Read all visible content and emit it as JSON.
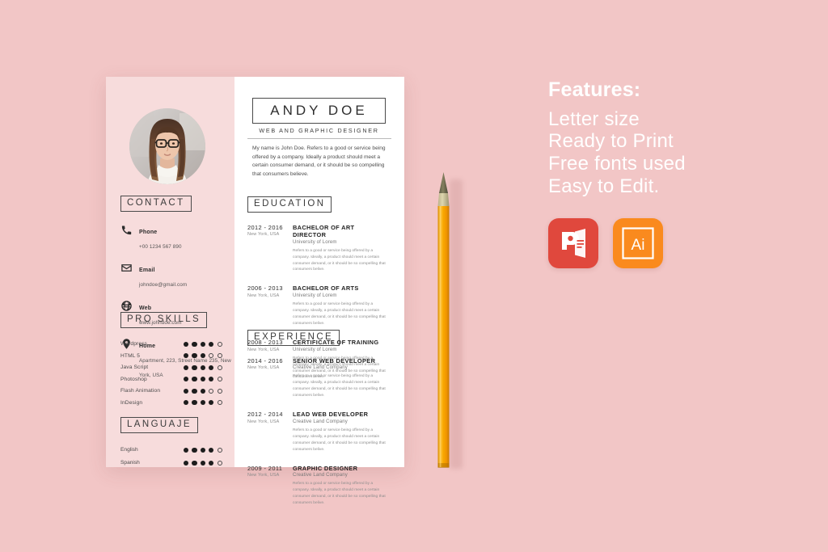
{
  "page": {
    "background_color": "#f2c6c6"
  },
  "resume": {
    "left_panel_color": "#f7dcdc",
    "right_panel_color": "#ffffff",
    "photo": {
      "icon": "profile-photo-woman-with-glasses",
      "shape": "circle"
    },
    "header": {
      "name": "ANDY DOE",
      "role": "WEB AND GRAPHIC DESIGNER",
      "intro": "My name is John Doe. Refers to a good or service being offered by a company. Ideally a product should meet a certain consumer demand, or it should be so compelling that consumers believe."
    },
    "contact": {
      "title": "CONTACT",
      "items": [
        {
          "icon": "phone-icon",
          "label": "Phone",
          "value": "+00 1234 567 890"
        },
        {
          "icon": "envelope-icon",
          "label": "Email",
          "value": "johndoe@gmail.com"
        },
        {
          "icon": "globe-icon",
          "label": "Web",
          "value": "www.johndoe.com"
        },
        {
          "icon": "location-pin-icon",
          "label": "Home",
          "value": "Apartment, 223, Street Name 235, New York, USA"
        }
      ]
    },
    "pro_skills": {
      "title": "PRO SKILLS",
      "max": 5,
      "items": [
        {
          "name": "Wordpress",
          "level": 4
        },
        {
          "name": "HTML 5",
          "level": 3
        },
        {
          "name": "Java Script",
          "level": 4
        },
        {
          "name": "Photoshop",
          "level": 4
        },
        {
          "name": "Flash Animation",
          "level": 3
        },
        {
          "name": "InDesign",
          "level": 4
        }
      ]
    },
    "language": {
      "title": "LANGUAJE",
      "max": 5,
      "items": [
        {
          "name": "English",
          "level": 4
        },
        {
          "name": "Spanish",
          "level": 4
        }
      ]
    },
    "education": {
      "title": "EDUCATION",
      "entries": [
        {
          "years": "2012 - 2016",
          "location": "New York, USA",
          "title": "BACHELOR OF ART DIRECTOR",
          "subtitle": "University of Lorem",
          "description": "Refers to a good or service being offered by a company. Ideally, a product should meet a certain consumer demand, or it should be so compelling that consumers belive."
        },
        {
          "years": "2006 - 2013",
          "location": "New York, USA",
          "title": "BACHELOR OF ARTS",
          "subtitle": "University of Lorem",
          "description": "Refers to a good or service being offered by a company. Ideally, a product should meet a certain consumer demand, or it should be so compelling that consumers belive."
        },
        {
          "years": "2008 - 2013",
          "location": "New York, USA",
          "title": "CERTIFICATE OF TRAINING",
          "subtitle": "University of Lorem",
          "description": "Refers to a good or service being offered by a company. Ideally, a product should meet a certain consumer demand, or it should be so compelling that consumers belive."
        }
      ]
    },
    "experience": {
      "title": "EXPERIENCE",
      "entries": [
        {
          "years": "2014 - 2016",
          "location": "New York, USA",
          "title": "SENIOR WEB DEVELOPER",
          "subtitle": "Creative Land Company",
          "description": "Refers to a good or service being offered by a company. Ideally, a product should meet a certain consumer demand, or it should be so compelling that consumers belive."
        },
        {
          "years": "2012 - 2014",
          "location": "New York, USA",
          "title": "LEAD WEB DEVELOPER",
          "subtitle": "Creative Land Company",
          "description": "Refers to a good or service being offered by a company. Ideally, a product should meet a certain consumer demand, or it should be so compelling that consumers belive."
        },
        {
          "years": "2009 - 2011",
          "location": "New York, USA",
          "title": "GRAPHIC DESIGNER",
          "subtitle": "Creative Land Company",
          "description": "Refers to a good or service being offered by a company. Ideally, a product should meet a certain consumer demand, or it should be so compelling that consumers belive."
        }
      ]
    }
  },
  "pencil": {
    "icon": "pencil-icon",
    "body_color": "#f2a100",
    "tip_color": "#7a7455"
  },
  "features": {
    "heading": "Features:",
    "lines": [
      "Letter size",
      "Ready to Print",
      "Free fonts used",
      "Easy to Edit."
    ],
    "text_color": "#ffffff"
  },
  "app_icons": [
    {
      "name": "powerpoint-icon",
      "label": "P",
      "color": "#e0483d"
    },
    {
      "name": "illustrator-icon",
      "label": "Ai",
      "color": "#fa8a1e"
    }
  ]
}
